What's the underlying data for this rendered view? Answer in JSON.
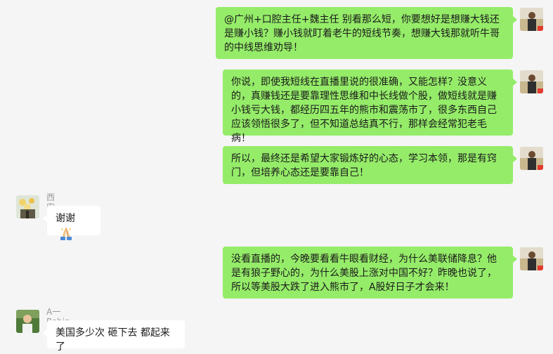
{
  "colors": {
    "background": "#f5f5f5",
    "outgoing_bubble": "#95ec69",
    "incoming_bubble": "#ffffff",
    "sender_name": "#9a9a9a"
  },
  "messages": [
    {
      "direction": "outgoing",
      "avatar_icon": "self-avatar-icon",
      "text": "@广州+口腔主任+魏主任 别看那么短，你要想好是想赚大钱还是赚小钱？赚小钱就盯着老牛的短线节奏，想赚大钱那就听牛哥的中线思维劝导！"
    },
    {
      "direction": "outgoing",
      "avatar_icon": "self-avatar-icon",
      "text": "你说，即使我短线在直播里说的很准确，又能怎样？没意义的，真赚钱还是要靠理性思维和中长线做个股，做短线就是赚小钱亏大钱，都经历四五年的熊市和震荡市了，很多东西自己应该领悟很多了，但不知道总结真不行，那样会经常犯老毛病！"
    },
    {
      "direction": "outgoing",
      "avatar_icon": "self-avatar-icon",
      "text": "所以，最终还是希望大家锻炼好的心态，学习本领，那是有窍门，但培养心态还是要靠自己！"
    },
    {
      "direction": "incoming",
      "sender": "西安-焱焱",
      "avatar_icon": "flower-avatar-icon",
      "text": "谢谢",
      "emoji_icon": "praying-hands-icon"
    },
    {
      "direction": "outgoing",
      "avatar_icon": "self-avatar-icon",
      "text": "没看直播的，今晚要看看牛眼看财经，为什么美联储降息？他是有狼子野心的，为什么美股上涨对中国不好？昨晚也说了，所以等美股大跌了进入熊市了，A股好日子才会来！"
    },
    {
      "direction": "incoming",
      "sender": "A一Robin",
      "avatar_icon": "person-avatar-icon",
      "text": "美国多少次 砸下去 都起来了"
    }
  ]
}
